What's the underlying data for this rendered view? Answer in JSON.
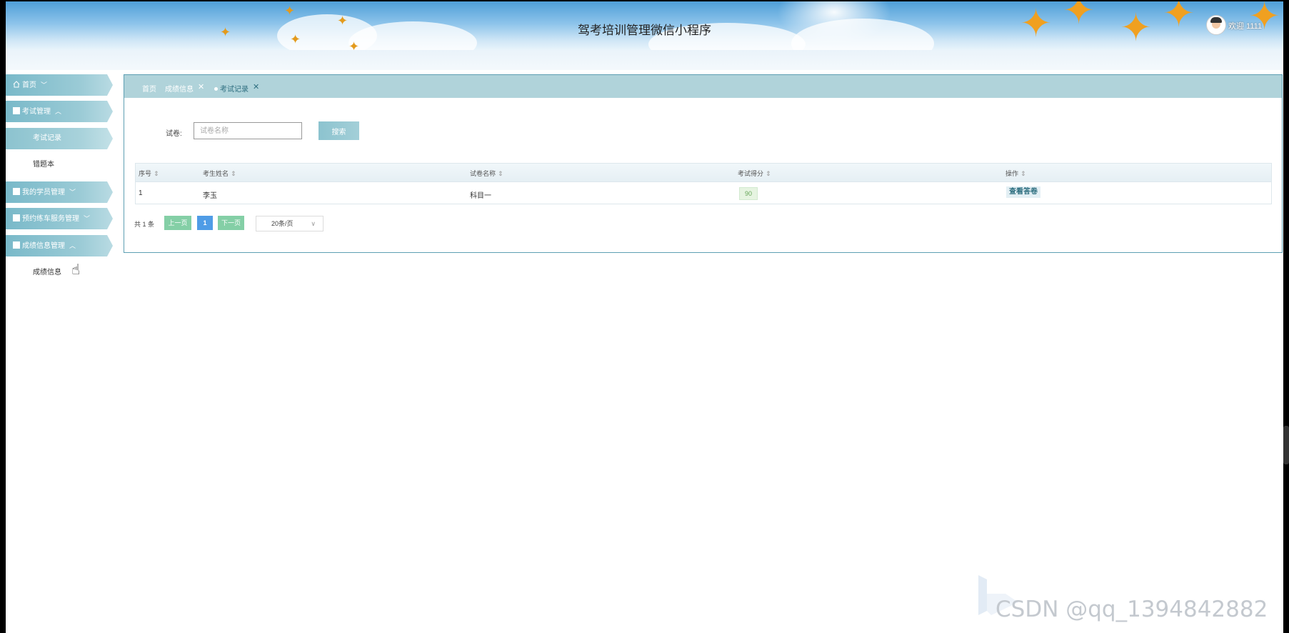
{
  "header": {
    "title": "驾考培训管理微信小程序",
    "welcome": "欢迎 1111"
  },
  "sidebar": {
    "items": [
      {
        "label": "首页",
        "chevron": "﹀"
      },
      {
        "label": "考试管理",
        "chevron": "︿"
      },
      {
        "label": "考试记录"
      },
      {
        "label": "错题本"
      },
      {
        "label": "我的学员管理",
        "chevron": "﹀"
      },
      {
        "label": "预约练车服务管理",
        "chevron": "﹀"
      },
      {
        "label": "成绩信息管理",
        "chevron": "︿"
      },
      {
        "label": "成绩信息"
      }
    ]
  },
  "tabs": [
    {
      "label": "首页"
    },
    {
      "label": "成绩信息",
      "close": "✕"
    },
    {
      "label": "考试记录",
      "close": "✕"
    }
  ],
  "search": {
    "label": "试卷:",
    "placeholder": "试卷名称",
    "button": "搜索"
  },
  "table": {
    "headers": [
      "序号",
      "考生姓名",
      "试卷名称",
      "考试得分",
      "操作"
    ],
    "sort_icon": "⇕",
    "rows": [
      {
        "index": "1",
        "name": "李玉",
        "paper": "科目一",
        "score": "90",
        "action": "查看答卷"
      }
    ]
  },
  "pagination": {
    "total": "共 1 条",
    "prev": "上一页",
    "page": "1",
    "next": "下一页",
    "page_size": "20条/页",
    "chevron": "∨"
  },
  "watermark": "CSDN @qq_1394842882",
  "colors": {
    "menu_accent": "#79b9c9",
    "tabbar": "#b0d3da",
    "pager_green": "#84cfa6",
    "pager_blue": "#4f9ce6"
  }
}
